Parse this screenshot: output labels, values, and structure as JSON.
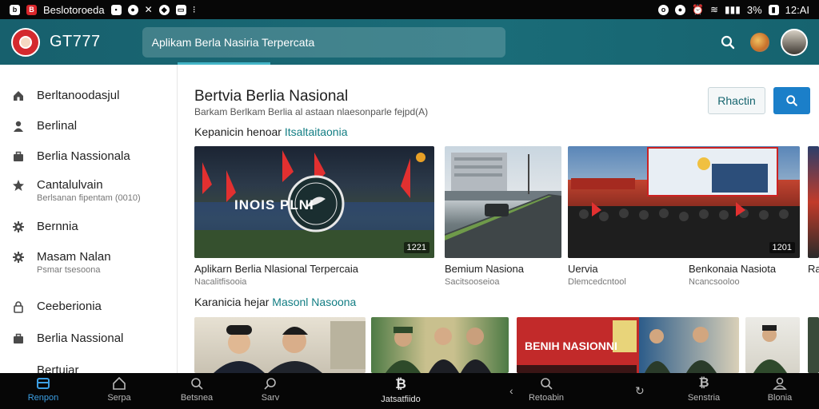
{
  "status_bar": {
    "left_text": "Beslotoroeda",
    "right_battery": "3%",
    "right_time": "12:AI"
  },
  "app": {
    "title": "GT777",
    "search_text": "Aplikam Berla Nasiria Terpercata"
  },
  "sidebar": {
    "items": [
      {
        "label": "Berltanoodasjul",
        "sub": "",
        "icon": "home-icon"
      },
      {
        "label": "Berlinal",
        "sub": "",
        "icon": "person-icon"
      },
      {
        "label": "Berlia Nassionala",
        "sub": "",
        "icon": "briefcase-icon"
      },
      {
        "label": "Cantalulvain",
        "sub": "Berlsanan fipentam (0010)",
        "icon": "star-icon"
      },
      {
        "label": "Bernnia",
        "sub": "",
        "icon": "gear-icon"
      },
      {
        "label": "Masam Nalan",
        "sub": "Psmar tsesoona",
        "icon": "gear-icon"
      },
      {
        "label": "Ceeberionia",
        "sub": "",
        "icon": "lock-icon"
      },
      {
        "label": "Berlia Nassional",
        "sub": "",
        "icon": "briefcase-icon"
      },
      {
        "label": "Bertuiar",
        "sub": "",
        "icon": "dots-icon"
      }
    ]
  },
  "header": {
    "title": "Bertvia Berlia Nasional",
    "subtitle": "Barkam Berlkam Berlia al astaan nlaesonparle  fejpd(A)",
    "button_label": "Rhactin"
  },
  "section1": {
    "title_main": "Kepanicin henoar",
    "title_accent": "Itsaltaitaonia",
    "cards": [
      {
        "title": "Aplikarn Berlia Nlasional Terpercaia",
        "meta": "Nacalitfisooia",
        "badge": "1221",
        "overlay": "INOIS  PLNI"
      },
      {
        "title": "Bemium Nasiona",
        "meta": "Sacitsooseioa"
      },
      {
        "title": "Uervia",
        "meta": "Dlemcedcntool",
        "title2": "Benkonaia Nasiota",
        "meta2": "Ncancsooloo",
        "badge": "1201"
      },
      {
        "title": "Ra",
        "meta": ""
      }
    ]
  },
  "section2": {
    "title_main": "Karanicia hejar",
    "title_accent": "Masonl Nasoona",
    "banner_text": "BENIH NASIONNI"
  },
  "bottom_nav": {
    "items": [
      {
        "label": "Renpon",
        "icon": "home-icon",
        "active": true
      },
      {
        "label": "Serpa",
        "icon": "house-outline-icon",
        "active": false
      },
      {
        "label": "Betsnea",
        "icon": "search-icon",
        "active": false
      },
      {
        "label": "Sarv",
        "icon": "search-icon",
        "active": false
      },
      {
        "label": "Jatsatfiido",
        "icon": "dollar-icon",
        "active": false
      },
      {
        "label": "Retoabin",
        "icon": "search-icon",
        "active": false
      },
      {
        "label": "Senstria",
        "icon": "dollar-icon",
        "active": false
      },
      {
        "label": "Blonia",
        "icon": "person-icon",
        "active": false
      }
    ]
  },
  "colors": {
    "appbar": "#17606d",
    "accent_blue": "#1b7fc9",
    "active_nav": "#3c9fe4",
    "accent_teal": "#127d83"
  }
}
